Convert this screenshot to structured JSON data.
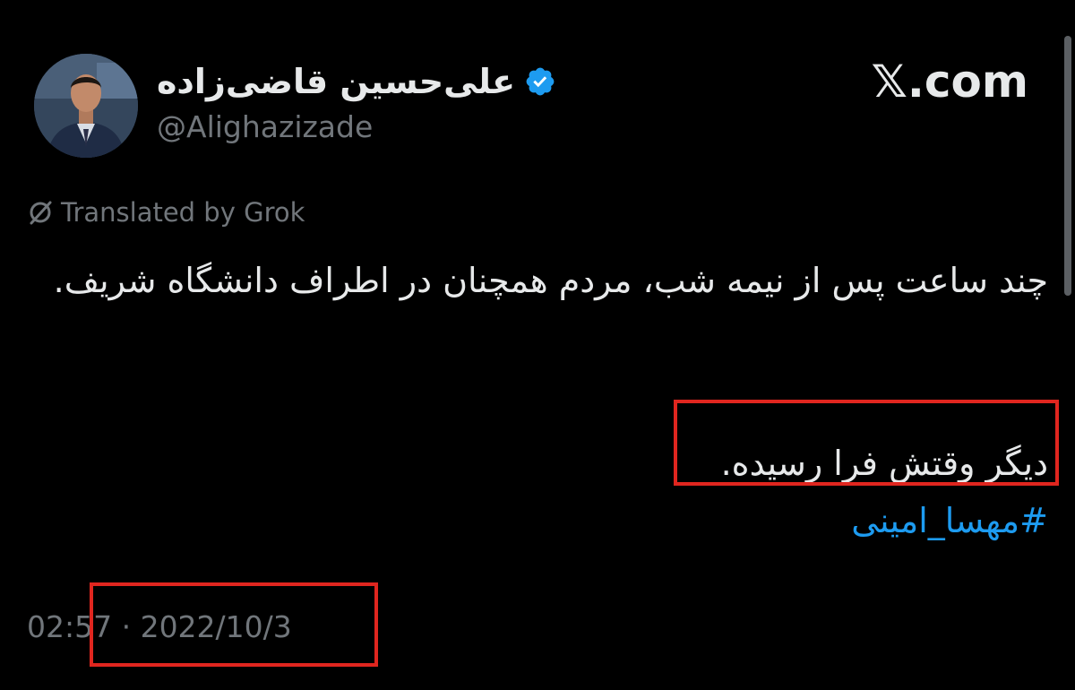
{
  "tweet": {
    "author": {
      "display_name": "علی‌حسین قاضی‌زاده",
      "handle": "@Alighazizade",
      "verified": true
    },
    "site_label": "𝕏.com",
    "translated_label": "Translated by Grok",
    "text_line_1": "چند ساعت پس از نیمه شب، مردم همچنان در اطراف دانشگاه شریف.",
    "text_line_2": "دیگر وقتش فرا رسیده.",
    "hashtag": "#مهسا_امینی",
    "timestamp": "02:57 · 2022/10/3"
  },
  "colors": {
    "background": "#000000",
    "primary_text": "#e7e9ea",
    "secondary_text": "#71767b",
    "link": "#1d9bf0",
    "verified_badge": "#1d9bf0",
    "annotation": "#e0261f"
  },
  "icons": {
    "verified": "verified-badge-icon",
    "grok": "grok-translate-icon"
  }
}
